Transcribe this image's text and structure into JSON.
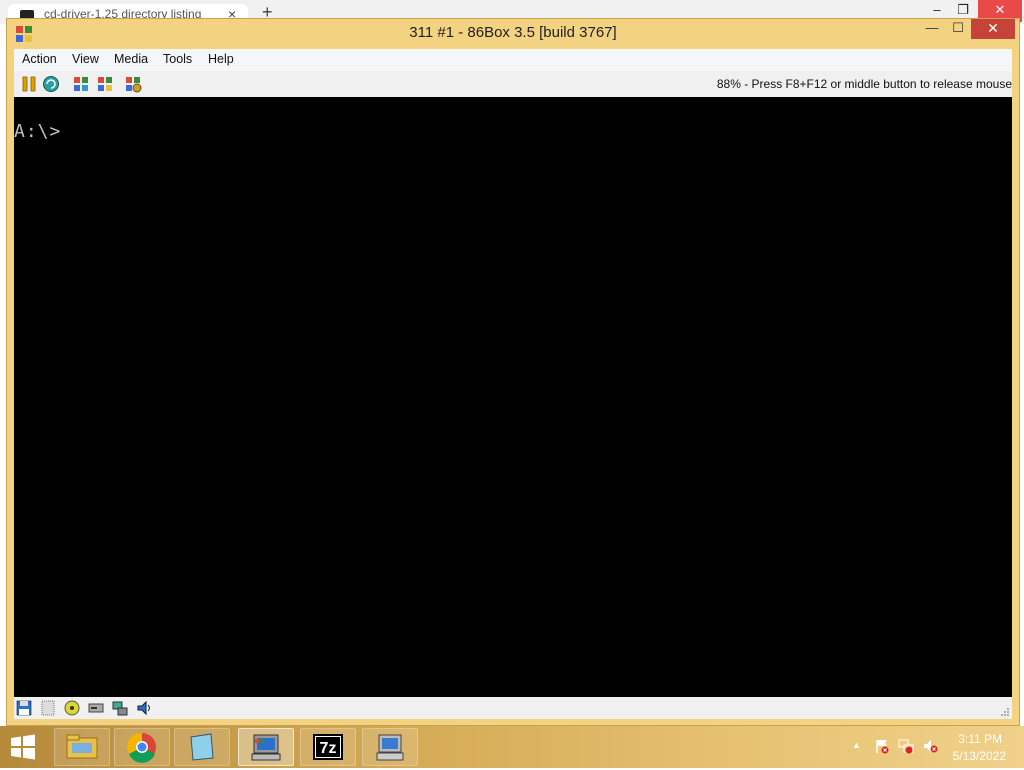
{
  "browser": {
    "tab_title": "cd-driver-1.25 directory listing",
    "tab_close": "×",
    "new_tab": "+",
    "minimize": "–",
    "restore": "❐",
    "close": "✕"
  },
  "window": {
    "title": "311 #1 - 86Box 3.5 [build 3767]",
    "minimize": "—",
    "maximize": "☐",
    "close": "✕"
  },
  "menu": {
    "items": [
      "Action",
      "View",
      "Media",
      "Tools",
      "Help"
    ]
  },
  "toolbar": {
    "icons": [
      "pause-icon",
      "reset-icon",
      "ctrl-alt-del-icon",
      "ctrl-alt-esc-icon",
      "settings-icon"
    ],
    "status_hint": "88% - Press F8+F12 or middle button to release mouse"
  },
  "screen": {
    "prompt": "A:\\>"
  },
  "statusbar": {
    "icons": [
      "floppy-icon",
      "cassette-icon",
      "cdrom-icon",
      "hard-disk-icon",
      "network-icon",
      "sound-icon"
    ]
  },
  "taskbar": {
    "apps": [
      "file-explorer-icon",
      "chrome-icon",
      "notepad-icon",
      "86box-icon",
      "7zip-icon",
      "computer-icon"
    ],
    "app_7z_label": "7z",
    "clock": {
      "time": "3:11 PM",
      "date": "5/13/2022"
    },
    "tray_arrow": "▲"
  },
  "colors": {
    "window_frame": "#f3d281",
    "screen_bg": "#000000",
    "close_button": "#c7433a",
    "dos_text": "#c0c0c0"
  }
}
